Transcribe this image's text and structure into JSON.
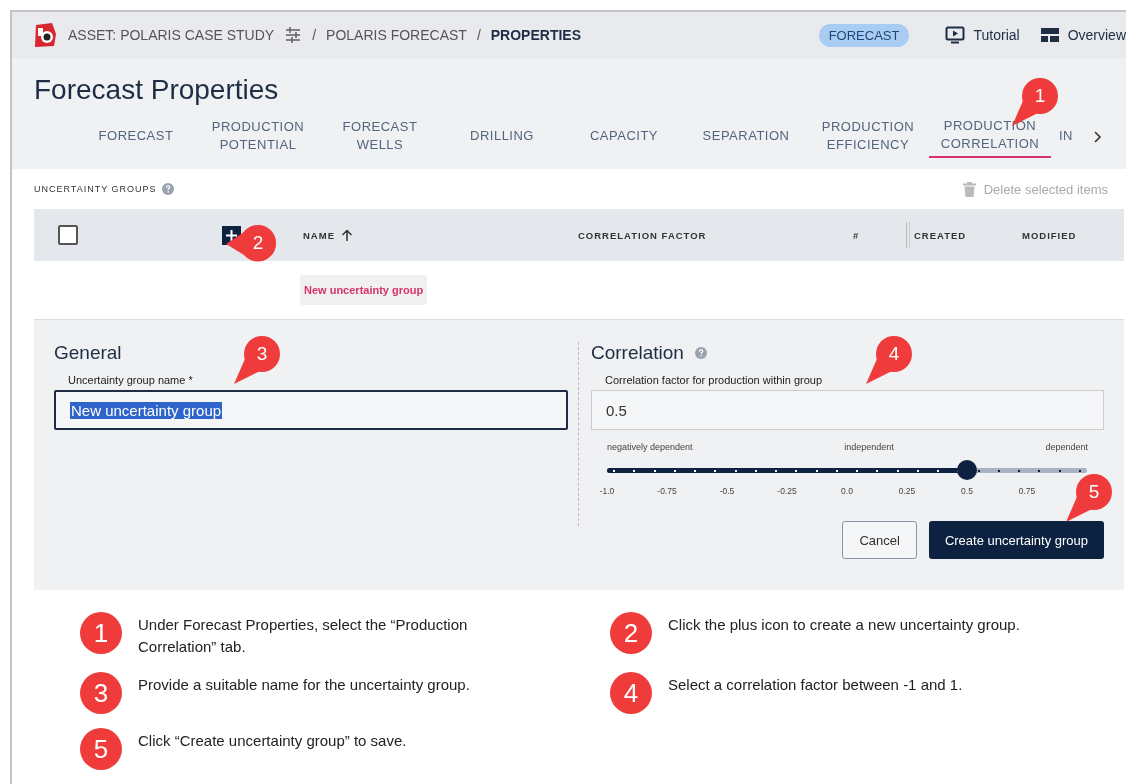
{
  "header": {
    "crumbs": [
      {
        "text": "ASSET: POLARIS CASE STUDY",
        "kind": "asset"
      },
      {
        "text": "/",
        "kind": "sep"
      },
      {
        "text": "POLARIS FORECAST",
        "kind": "link"
      },
      {
        "text": "/",
        "kind": "sep"
      },
      {
        "text": "PROPERTIES",
        "kind": "current"
      }
    ],
    "badge": "FORECAST",
    "links": [
      {
        "text": "Tutorial",
        "kind": "tutorial"
      },
      {
        "text": "Overview",
        "kind": "overview"
      }
    ]
  },
  "page_title": "Forecast Properties",
  "tabs": [
    {
      "label": "FORECAST",
      "selected": false
    },
    {
      "label": "PRODUCTION POTENTIAL",
      "selected": false
    },
    {
      "label": "FORECAST WELLS",
      "selected": false
    },
    {
      "label": "DRILLING",
      "selected": false
    },
    {
      "label": "CAPACITY",
      "selected": false
    },
    {
      "label": "SEPARATION",
      "selected": false
    },
    {
      "label": "PRODUCTION EFFICIENCY",
      "selected": false
    },
    {
      "label": "PRODUCTION CORRELATION",
      "selected": true
    },
    {
      "label": "IN",
      "selected": false
    }
  ],
  "uncertainty_groups": {
    "label": "UNCERTAINTY GROUPS",
    "delete_action": {
      "text": "Delete selected items",
      "disabled": true
    },
    "select_all": {
      "checked": false
    },
    "columns": [
      {
        "label": "NAME",
        "sorted": true
      },
      {
        "label": "CORRELATION FACTOR",
        "sorted": false
      },
      {
        "label": "#",
        "sorted": false
      },
      {
        "label": "CREATED",
        "sorted": false
      },
      {
        "label": "MODIFIED",
        "sorted": false
      }
    ],
    "new_row": "New uncertainty group"
  },
  "form": {
    "general": {
      "heading": "General",
      "field_label": "Uncertainty group name *",
      "value": "New uncertainty group"
    },
    "correlation": {
      "heading": "Correlation",
      "field_label": "Correlation factor for production within group",
      "value": "0.5",
      "slider": {
        "level": 0.75,
        "labels": [
          "negatively dependent",
          "independent",
          "dependent"
        ],
        "ticks": [
          "-1.0",
          "-0.75",
          "-0.5",
          "-0.25",
          "0.0",
          "0.25",
          "0.5",
          "0.75"
        ]
      }
    },
    "buttons": [
      {
        "text": "Cancel",
        "kind": "secondary"
      },
      {
        "text": "Create uncertainty group",
        "kind": "primary"
      }
    ]
  },
  "callouts": [
    "1",
    "2",
    "3",
    "4",
    "5"
  ],
  "instructions": [
    {
      "number": "1",
      "text": "Under Forecast Properties, select the “Production Correlation” tab."
    },
    {
      "number": "2",
      "text": "Click the plus icon to create a new uncertainty group."
    },
    {
      "number": "3",
      "text": "Provide a suitable name for the uncertainty group."
    },
    {
      "number": "4",
      "text": "Select a correlation factor between -1 and 1."
    },
    {
      "number": "5",
      "text": "Click “Create uncertainty group” to save."
    }
  ]
}
